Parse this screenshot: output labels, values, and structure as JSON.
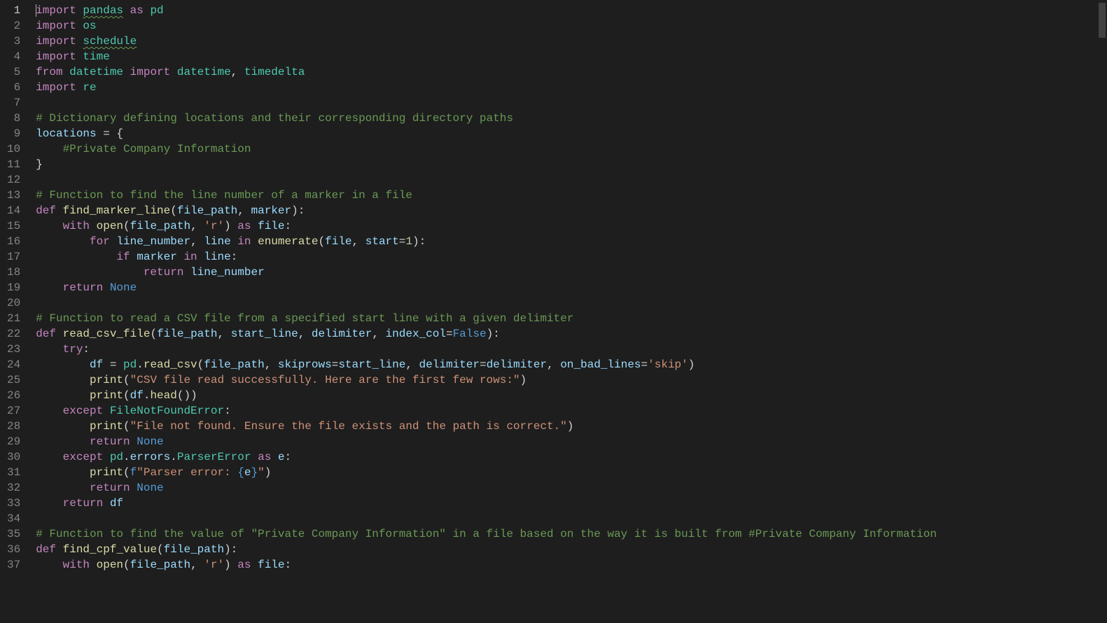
{
  "editor": {
    "active_line": 1,
    "lines": [
      {
        "n": 1,
        "tokens": [
          {
            "t": "import",
            "c": "kw"
          },
          {
            "t": " ",
            "c": "op"
          },
          {
            "t": "pandas",
            "c": "mod squiggle"
          },
          {
            "t": " ",
            "c": "op"
          },
          {
            "t": "as",
            "c": "kw"
          },
          {
            "t": " ",
            "c": "op"
          },
          {
            "t": "pd",
            "c": "mod"
          }
        ]
      },
      {
        "n": 2,
        "tokens": [
          {
            "t": "import",
            "c": "kw"
          },
          {
            "t": " ",
            "c": "op"
          },
          {
            "t": "os",
            "c": "mod"
          }
        ]
      },
      {
        "n": 3,
        "tokens": [
          {
            "t": "import",
            "c": "kw"
          },
          {
            "t": " ",
            "c": "op"
          },
          {
            "t": "schedule",
            "c": "mod squiggle"
          }
        ]
      },
      {
        "n": 4,
        "tokens": [
          {
            "t": "import",
            "c": "kw"
          },
          {
            "t": " ",
            "c": "op"
          },
          {
            "t": "time",
            "c": "mod"
          }
        ]
      },
      {
        "n": 5,
        "tokens": [
          {
            "t": "from",
            "c": "kw"
          },
          {
            "t": " ",
            "c": "op"
          },
          {
            "t": "datetime",
            "c": "mod"
          },
          {
            "t": " ",
            "c": "op"
          },
          {
            "t": "import",
            "c": "kw"
          },
          {
            "t": " ",
            "c": "op"
          },
          {
            "t": "datetime",
            "c": "mod"
          },
          {
            "t": ", ",
            "c": "op"
          },
          {
            "t": "timedelta",
            "c": "mod"
          }
        ]
      },
      {
        "n": 6,
        "tokens": [
          {
            "t": "import",
            "c": "kw"
          },
          {
            "t": " ",
            "c": "op"
          },
          {
            "t": "re",
            "c": "mod"
          }
        ]
      },
      {
        "n": 7,
        "tokens": []
      },
      {
        "n": 8,
        "tokens": [
          {
            "t": "# Dictionary defining locations and their corresponding directory paths",
            "c": "cmt"
          }
        ]
      },
      {
        "n": 9,
        "tokens": [
          {
            "t": "locations",
            "c": "var"
          },
          {
            "t": " = {",
            "c": "op"
          }
        ]
      },
      {
        "n": 10,
        "tokens": [
          {
            "t": "    ",
            "c": "op"
          },
          {
            "t": "#Private Company Information",
            "c": "cmt"
          }
        ]
      },
      {
        "n": 11,
        "tokens": [
          {
            "t": "}",
            "c": "op"
          }
        ]
      },
      {
        "n": 12,
        "tokens": []
      },
      {
        "n": 13,
        "tokens": [
          {
            "t": "# Function to find the line number of a marker in a file",
            "c": "cmt"
          }
        ]
      },
      {
        "n": 14,
        "tokens": [
          {
            "t": "def",
            "c": "kw"
          },
          {
            "t": " ",
            "c": "op"
          },
          {
            "t": "find_marker_line",
            "c": "fn"
          },
          {
            "t": "(",
            "c": "op"
          },
          {
            "t": "file_path",
            "c": "param"
          },
          {
            "t": ", ",
            "c": "op"
          },
          {
            "t": "marker",
            "c": "param"
          },
          {
            "t": "):",
            "c": "op"
          }
        ]
      },
      {
        "n": 15,
        "tokens": [
          {
            "t": "    ",
            "c": "op"
          },
          {
            "t": "with",
            "c": "kw"
          },
          {
            "t": " ",
            "c": "op"
          },
          {
            "t": "open",
            "c": "builtin"
          },
          {
            "t": "(",
            "c": "op"
          },
          {
            "t": "file_path",
            "c": "var"
          },
          {
            "t": ", ",
            "c": "op"
          },
          {
            "t": "'r'",
            "c": "str"
          },
          {
            "t": ") ",
            "c": "op"
          },
          {
            "t": "as",
            "c": "kw"
          },
          {
            "t": " ",
            "c": "op"
          },
          {
            "t": "file",
            "c": "var"
          },
          {
            "t": ":",
            "c": "op"
          }
        ]
      },
      {
        "n": 16,
        "tokens": [
          {
            "t": "        ",
            "c": "op"
          },
          {
            "t": "for",
            "c": "kw"
          },
          {
            "t": " ",
            "c": "op"
          },
          {
            "t": "line_number",
            "c": "var"
          },
          {
            "t": ", ",
            "c": "op"
          },
          {
            "t": "line",
            "c": "var"
          },
          {
            "t": " ",
            "c": "op"
          },
          {
            "t": "in",
            "c": "kw"
          },
          {
            "t": " ",
            "c": "op"
          },
          {
            "t": "enumerate",
            "c": "builtin"
          },
          {
            "t": "(",
            "c": "op"
          },
          {
            "t": "file",
            "c": "var"
          },
          {
            "t": ", ",
            "c": "op"
          },
          {
            "t": "start",
            "c": "var"
          },
          {
            "t": "=",
            "c": "op"
          },
          {
            "t": "1",
            "c": "num"
          },
          {
            "t": "):",
            "c": "op"
          }
        ]
      },
      {
        "n": 17,
        "tokens": [
          {
            "t": "            ",
            "c": "op"
          },
          {
            "t": "if",
            "c": "kw"
          },
          {
            "t": " ",
            "c": "op"
          },
          {
            "t": "marker",
            "c": "var"
          },
          {
            "t": " ",
            "c": "op"
          },
          {
            "t": "in",
            "c": "kw"
          },
          {
            "t": " ",
            "c": "op"
          },
          {
            "t": "line",
            "c": "var"
          },
          {
            "t": ":",
            "c": "op"
          }
        ]
      },
      {
        "n": 18,
        "tokens": [
          {
            "t": "                ",
            "c": "op"
          },
          {
            "t": "return",
            "c": "kw"
          },
          {
            "t": " ",
            "c": "op"
          },
          {
            "t": "line_number",
            "c": "var"
          }
        ]
      },
      {
        "n": 19,
        "tokens": [
          {
            "t": "    ",
            "c": "op"
          },
          {
            "t": "return",
            "c": "kw"
          },
          {
            "t": " ",
            "c": "op"
          },
          {
            "t": "None",
            "c": "const"
          }
        ]
      },
      {
        "n": 20,
        "tokens": []
      },
      {
        "n": 21,
        "tokens": [
          {
            "t": "# Function to read a CSV file from a specified start line with a given delimiter",
            "c": "cmt"
          }
        ]
      },
      {
        "n": 22,
        "tokens": [
          {
            "t": "def",
            "c": "kw"
          },
          {
            "t": " ",
            "c": "op"
          },
          {
            "t": "read_csv_file",
            "c": "fn"
          },
          {
            "t": "(",
            "c": "op"
          },
          {
            "t": "file_path",
            "c": "param"
          },
          {
            "t": ", ",
            "c": "op"
          },
          {
            "t": "start_line",
            "c": "param"
          },
          {
            "t": ", ",
            "c": "op"
          },
          {
            "t": "delimiter",
            "c": "param"
          },
          {
            "t": ", ",
            "c": "op"
          },
          {
            "t": "index_col",
            "c": "param"
          },
          {
            "t": "=",
            "c": "op"
          },
          {
            "t": "False",
            "c": "const"
          },
          {
            "t": "):",
            "c": "op"
          }
        ]
      },
      {
        "n": 23,
        "tokens": [
          {
            "t": "    ",
            "c": "op"
          },
          {
            "t": "try",
            "c": "kw"
          },
          {
            "t": ":",
            "c": "op"
          }
        ]
      },
      {
        "n": 24,
        "tokens": [
          {
            "t": "        ",
            "c": "op"
          },
          {
            "t": "df",
            "c": "var"
          },
          {
            "t": " = ",
            "c": "op"
          },
          {
            "t": "pd",
            "c": "mod"
          },
          {
            "t": ".",
            "c": "op"
          },
          {
            "t": "read_csv",
            "c": "fn"
          },
          {
            "t": "(",
            "c": "op"
          },
          {
            "t": "file_path",
            "c": "var"
          },
          {
            "t": ", ",
            "c": "op"
          },
          {
            "t": "skiprows",
            "c": "var"
          },
          {
            "t": "=",
            "c": "op"
          },
          {
            "t": "start_line",
            "c": "var"
          },
          {
            "t": ", ",
            "c": "op"
          },
          {
            "t": "delimiter",
            "c": "var"
          },
          {
            "t": "=",
            "c": "op"
          },
          {
            "t": "delimiter",
            "c": "var"
          },
          {
            "t": ", ",
            "c": "op"
          },
          {
            "t": "on_bad_lines",
            "c": "var"
          },
          {
            "t": "=",
            "c": "op"
          },
          {
            "t": "'skip'",
            "c": "str"
          },
          {
            "t": ")",
            "c": "op"
          }
        ]
      },
      {
        "n": 25,
        "tokens": [
          {
            "t": "        ",
            "c": "op"
          },
          {
            "t": "print",
            "c": "builtin"
          },
          {
            "t": "(",
            "c": "op"
          },
          {
            "t": "\"CSV file read successfully. Here are the first few rows:\"",
            "c": "str"
          },
          {
            "t": ")",
            "c": "op"
          }
        ]
      },
      {
        "n": 26,
        "tokens": [
          {
            "t": "        ",
            "c": "op"
          },
          {
            "t": "print",
            "c": "builtin"
          },
          {
            "t": "(",
            "c": "op"
          },
          {
            "t": "df",
            "c": "var"
          },
          {
            "t": ".",
            "c": "op"
          },
          {
            "t": "head",
            "c": "fn"
          },
          {
            "t": "())",
            "c": "op"
          }
        ]
      },
      {
        "n": 27,
        "tokens": [
          {
            "t": "    ",
            "c": "op"
          },
          {
            "t": "except",
            "c": "kw"
          },
          {
            "t": " ",
            "c": "op"
          },
          {
            "t": "FileNotFoundError",
            "c": "cls"
          },
          {
            "t": ":",
            "c": "op"
          }
        ]
      },
      {
        "n": 28,
        "tokens": [
          {
            "t": "        ",
            "c": "op"
          },
          {
            "t": "print",
            "c": "builtin"
          },
          {
            "t": "(",
            "c": "op"
          },
          {
            "t": "\"File not found. Ensure the file exists and the path is correct.\"",
            "c": "str"
          },
          {
            "t": ")",
            "c": "op"
          }
        ]
      },
      {
        "n": 29,
        "tokens": [
          {
            "t": "        ",
            "c": "op"
          },
          {
            "t": "return",
            "c": "kw"
          },
          {
            "t": " ",
            "c": "op"
          },
          {
            "t": "None",
            "c": "const"
          }
        ]
      },
      {
        "n": 30,
        "tokens": [
          {
            "t": "    ",
            "c": "op"
          },
          {
            "t": "except",
            "c": "kw"
          },
          {
            "t": " ",
            "c": "op"
          },
          {
            "t": "pd",
            "c": "mod"
          },
          {
            "t": ".",
            "c": "op"
          },
          {
            "t": "errors",
            "c": "var"
          },
          {
            "t": ".",
            "c": "op"
          },
          {
            "t": "ParserError",
            "c": "cls"
          },
          {
            "t": " ",
            "c": "op"
          },
          {
            "t": "as",
            "c": "kw"
          },
          {
            "t": " ",
            "c": "op"
          },
          {
            "t": "e",
            "c": "var"
          },
          {
            "t": ":",
            "c": "op"
          }
        ]
      },
      {
        "n": 31,
        "tokens": [
          {
            "t": "        ",
            "c": "op"
          },
          {
            "t": "print",
            "c": "builtin"
          },
          {
            "t": "(",
            "c": "op"
          },
          {
            "t": "f",
            "c": "const"
          },
          {
            "t": "\"Parser error: ",
            "c": "str"
          },
          {
            "t": "{",
            "c": "const"
          },
          {
            "t": "e",
            "c": "var"
          },
          {
            "t": "}",
            "c": "const"
          },
          {
            "t": "\"",
            "c": "str"
          },
          {
            "t": ")",
            "c": "op"
          }
        ]
      },
      {
        "n": 32,
        "tokens": [
          {
            "t": "        ",
            "c": "op"
          },
          {
            "t": "return",
            "c": "kw"
          },
          {
            "t": " ",
            "c": "op"
          },
          {
            "t": "None",
            "c": "const"
          }
        ]
      },
      {
        "n": 33,
        "tokens": [
          {
            "t": "    ",
            "c": "op"
          },
          {
            "t": "return",
            "c": "kw"
          },
          {
            "t": " ",
            "c": "op"
          },
          {
            "t": "df",
            "c": "var"
          }
        ]
      },
      {
        "n": 34,
        "tokens": []
      },
      {
        "n": 35,
        "tokens": [
          {
            "t": "# Function to find the value of \"Private Company Information\" in a file based on the way it is built from #Private Company Information",
            "c": "cmt"
          }
        ]
      },
      {
        "n": 36,
        "tokens": [
          {
            "t": "def",
            "c": "kw"
          },
          {
            "t": " ",
            "c": "op"
          },
          {
            "t": "find_cpf_value",
            "c": "fn"
          },
          {
            "t": "(",
            "c": "op"
          },
          {
            "t": "file_path",
            "c": "param"
          },
          {
            "t": "):",
            "c": "op"
          }
        ]
      },
      {
        "n": 37,
        "tokens": [
          {
            "t": "    ",
            "c": "op"
          },
          {
            "t": "with",
            "c": "kw"
          },
          {
            "t": " ",
            "c": "op"
          },
          {
            "t": "open",
            "c": "builtin"
          },
          {
            "t": "(",
            "c": "op"
          },
          {
            "t": "file_path",
            "c": "var"
          },
          {
            "t": ", ",
            "c": "op"
          },
          {
            "t": "'r'",
            "c": "str"
          },
          {
            "t": ") ",
            "c": "op"
          },
          {
            "t": "as",
            "c": "kw"
          },
          {
            "t": " ",
            "c": "op"
          },
          {
            "t": "file",
            "c": "var"
          },
          {
            "t": ":",
            "c": "op"
          }
        ]
      }
    ]
  }
}
